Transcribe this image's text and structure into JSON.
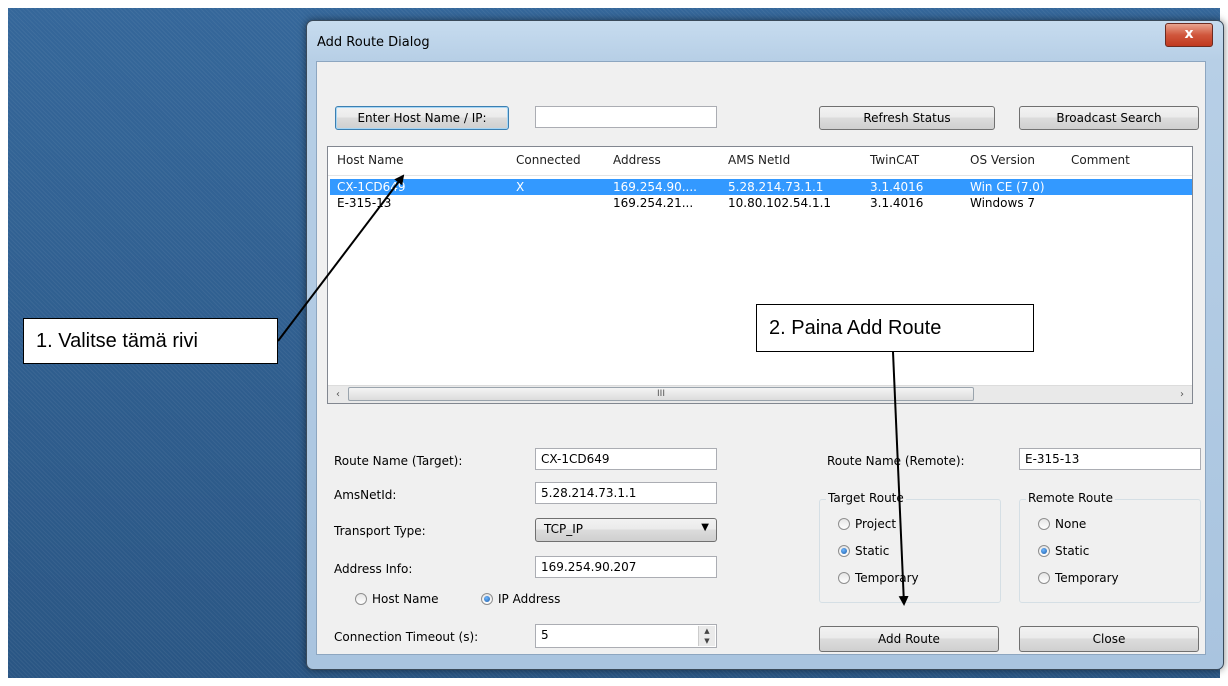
{
  "dialog": {
    "title": "Add Route Dialog",
    "close_glyph": "x"
  },
  "top": {
    "enter_host_label": "Enter Host Name / IP:",
    "host_input_value": "",
    "refresh_label": "Refresh Status",
    "broadcast_label": "Broadcast Search"
  },
  "list": {
    "columns": [
      "Host Name",
      "Connected",
      "Address",
      "AMS NetId",
      "TwinCAT",
      "OS Version",
      "Comment"
    ],
    "rows": [
      {
        "host": "CX-1CD649",
        "connected": "X",
        "address": "169.254.90....",
        "ams": "5.28.214.73.1.1",
        "twincat": "3.1.4016",
        "os": "Win CE (7.0)",
        "comment": ""
      },
      {
        "host": "E-315-13",
        "connected": "",
        "address": "169.254.21...",
        "ams": "10.80.102.54.1.1",
        "twincat": "3.1.4016",
        "os": "Windows 7",
        "comment": ""
      }
    ],
    "scroll_left": "‹",
    "scroll_right": "›",
    "scroll_grip": "III"
  },
  "form": {
    "route_name_target_label": "Route Name (Target):",
    "route_name_target_value": "CX-1CD649",
    "amsnetid_label": "AmsNetId:",
    "amsnetid_value": "5.28.214.73.1.1",
    "transport_label": "Transport Type:",
    "transport_value": "TCP_IP",
    "address_label": "Address Info:",
    "address_value": "169.254.90.207",
    "opt_host_name": "Host Name",
    "opt_ip_address": "IP Address",
    "timeout_label": "Connection Timeout (s):",
    "timeout_value": "5",
    "route_name_remote_label": "Route Name (Remote):",
    "route_name_remote_value": "E-315-13",
    "target_route_title": "Target Route",
    "target_options": [
      "Project",
      "Static",
      "Temporary"
    ],
    "remote_route_title": "Remote Route",
    "remote_options": [
      "None",
      "Static",
      "Temporary"
    ]
  },
  "buttons": {
    "add_route": "Add Route",
    "close": "Close"
  },
  "annotations": {
    "step1": "1. Valitse tämä rivi",
    "step2": "2. Paina Add Route"
  },
  "colors": {
    "selection": "#3399ff",
    "desktop": "#2f5b86"
  }
}
